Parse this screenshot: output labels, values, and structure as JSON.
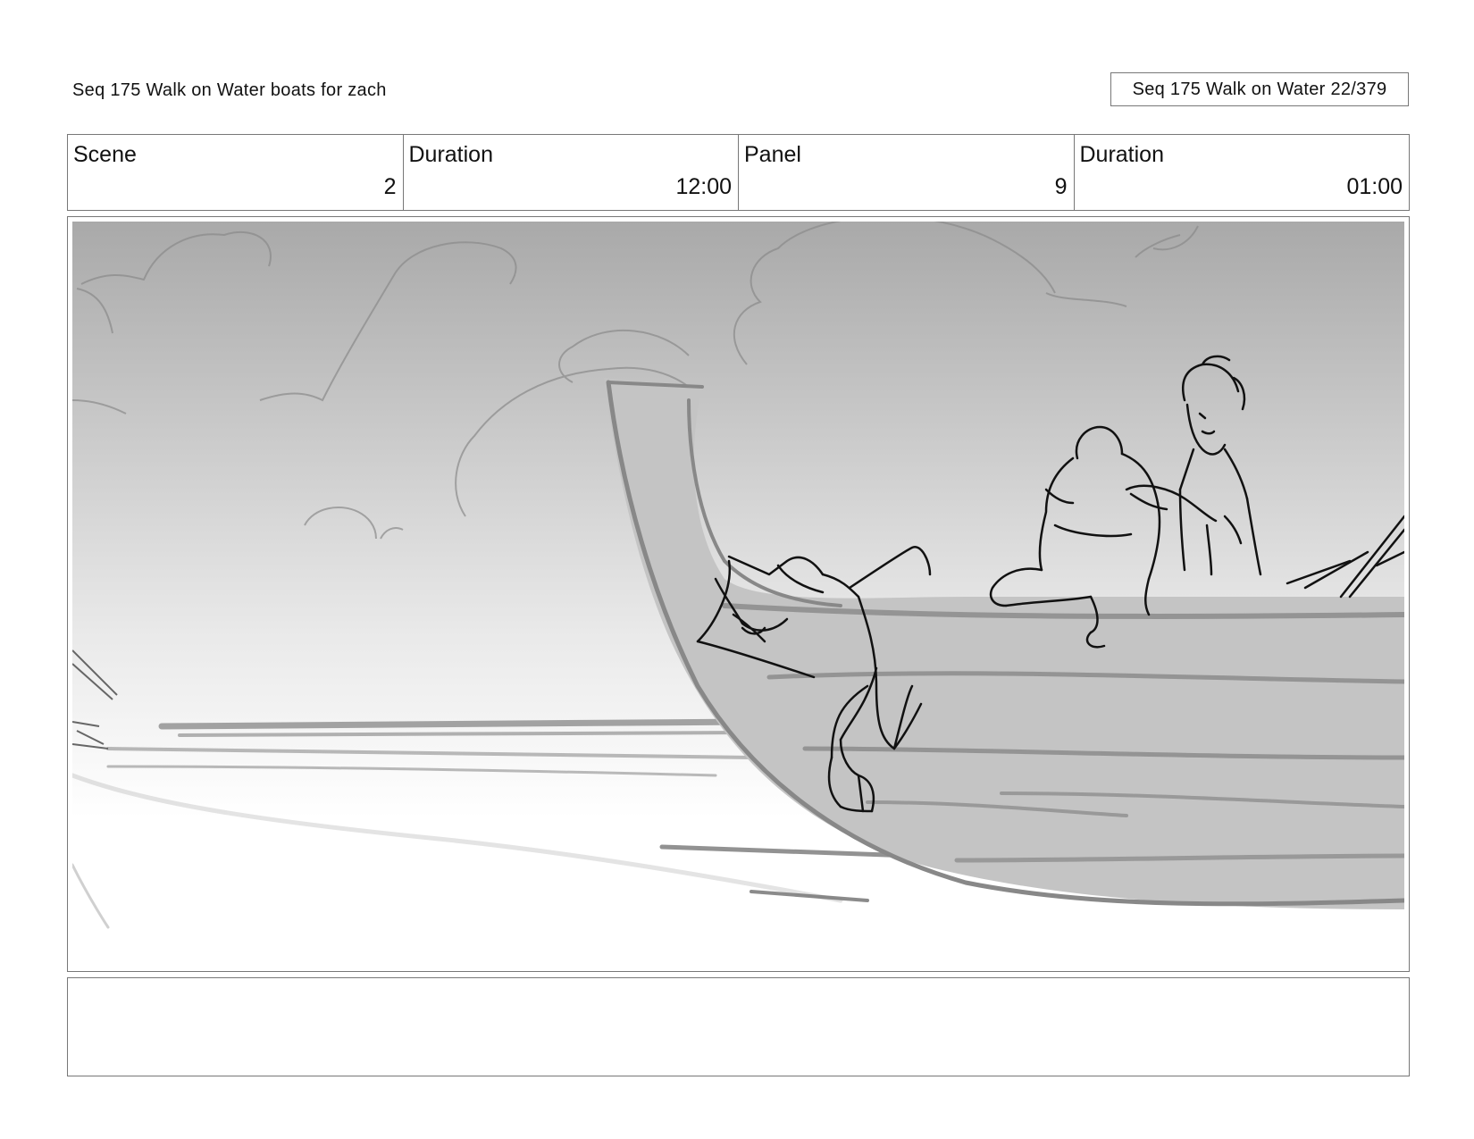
{
  "header": {
    "left_title": "Seq 175 Walk on Water  boats for zach",
    "right_title": "Seq 175 Walk on Water  22/379"
  },
  "info": {
    "scene_label": "Scene",
    "scene_value": "2",
    "scene_duration_label": "Duration",
    "scene_duration_value": "12:00",
    "panel_label": "Panel",
    "panel_value": "9",
    "panel_duration_label": "Duration",
    "panel_duration_value": "01:00"
  },
  "notes": {
    "text": ""
  },
  "colors": {
    "border": "#777777",
    "sky_top": "#a8a8a8",
    "sky_bottom": "#ffffff",
    "hull": "#c4c4c4",
    "sketch_line": "#111111"
  }
}
